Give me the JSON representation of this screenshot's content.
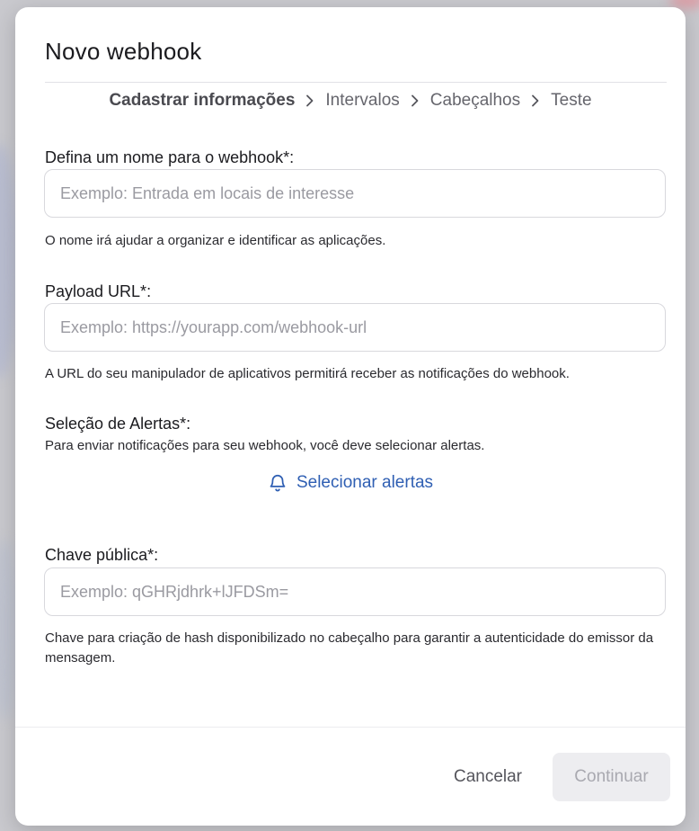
{
  "modal": {
    "title": "Novo webhook"
  },
  "stepper": {
    "steps": [
      {
        "label": "Cadastrar informações",
        "active": true
      },
      {
        "label": "Intervalos",
        "active": false
      },
      {
        "label": "Cabeçalhos",
        "active": false
      },
      {
        "label": "Teste",
        "active": false
      }
    ]
  },
  "form": {
    "name": {
      "label": "Defina um nome para o webhook*:",
      "placeholder": "Exemplo: Entrada em locais de interesse",
      "value": "",
      "helper": "O nome irá ajudar a organizar e identificar as aplicações."
    },
    "payload_url": {
      "label": "Payload URL*:",
      "placeholder": "Exemplo: https://yourapp.com/webhook-url",
      "value": "",
      "helper": "A URL do seu manipulador de aplicativos permitirá receber as notificações do webhook."
    },
    "alerts": {
      "label": "Seleção de Alertas*:",
      "helper": "Para enviar notificações para seu webhook, você deve selecionar alertas.",
      "button_label": "Selecionar alertas",
      "button_icon": "bell-icon"
    },
    "public_key": {
      "label": "Chave pública*:",
      "placeholder": "Exemplo: qGHRjdhrk+lJFDSm=",
      "value": "",
      "helper": "Chave para criação de hash disponibilizado no cabeçalho para garantir a autenticidade do emissor da mensagem."
    }
  },
  "footer": {
    "cancel_label": "Cancelar",
    "continue_label": "Continuar"
  },
  "colors": {
    "accent": "#2f5fb3",
    "disabled_bg": "#ededf0",
    "disabled_text": "#a9a9b0"
  }
}
